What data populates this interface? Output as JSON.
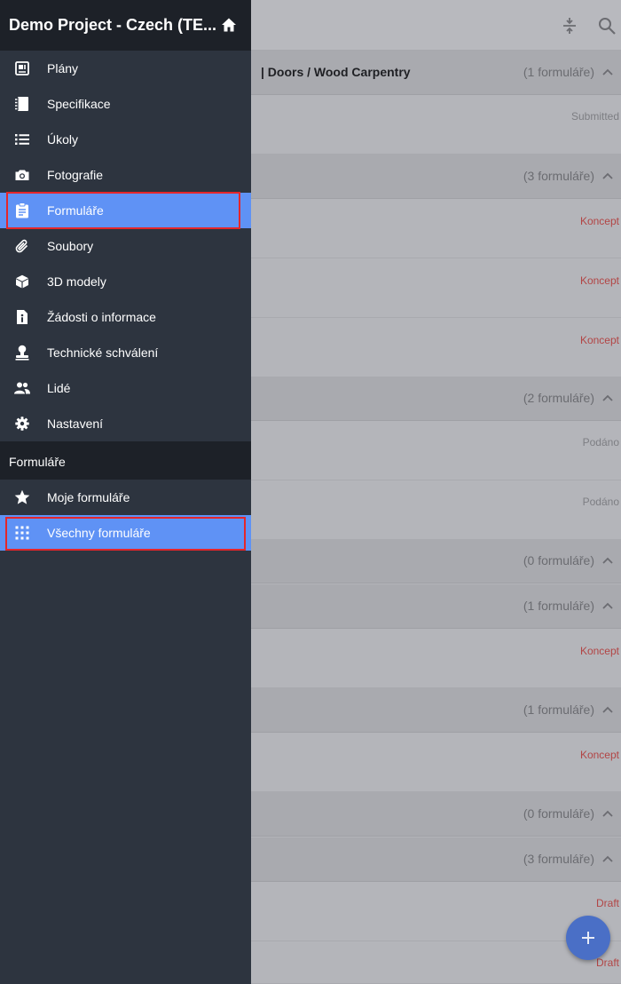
{
  "drawer": {
    "title": "Demo Project - Czech (TE...",
    "items": [
      {
        "label": "Plány",
        "icon": "plans-icon"
      },
      {
        "label": "Specifikace",
        "icon": "notebook-icon"
      },
      {
        "label": "Úkoly",
        "icon": "list-icon"
      },
      {
        "label": "Fotografie",
        "icon": "camera-icon"
      },
      {
        "label": "Formuláře",
        "icon": "clipboard-icon",
        "active": true
      },
      {
        "label": "Soubory",
        "icon": "paperclip-icon"
      },
      {
        "label": "3D modely",
        "icon": "cube-icon"
      },
      {
        "label": "Žádosti o informace",
        "icon": "info-doc-icon"
      },
      {
        "label": "Technické schválení",
        "icon": "stamp-icon"
      },
      {
        "label": "Lidé",
        "icon": "people-icon"
      },
      {
        "label": "Nastavení",
        "icon": "gear-icon"
      }
    ],
    "section_title": "Formuláře",
    "sub_items": [
      {
        "label": "Moje formuláře",
        "icon": "star-icon"
      },
      {
        "label": "Všechny formuláře",
        "icon": "apps-grid-icon",
        "active": true
      }
    ]
  },
  "background": {
    "groups": [
      {
        "title": "| Doors / Wood Carpentry",
        "count": "(1 formuláře)"
      },
      {
        "title": "",
        "count": "(3 formuláře)"
      },
      {
        "title": "",
        "count": "(2 formuláře)"
      },
      {
        "title": "",
        "count": "(0 formuláře)"
      },
      {
        "title": "",
        "count": "(1 formuláře)"
      },
      {
        "title": "",
        "count": "(1 formuláře)"
      },
      {
        "title": "",
        "count": "(0 formuláře)"
      },
      {
        "title": "",
        "count": "(3 formuláře)"
      }
    ],
    "rows": [
      {
        "status": "Submitted"
      },
      {
        "status": "Koncept"
      },
      {
        "status": "Koncept"
      },
      {
        "status": "Koncept"
      },
      {
        "status": "Podáno"
      },
      {
        "status": "Podáno"
      },
      {
        "status": "Koncept"
      },
      {
        "status": "Koncept"
      },
      {
        "status": "Draft"
      },
      {
        "status": "Draft"
      }
    ]
  },
  "colors": {
    "drawer_bg": "#2d343f",
    "drawer_header": "#1d2128",
    "active_item": "#5f92f5",
    "highlight_border": "#e5262a",
    "fab": "#4a6fc6"
  }
}
